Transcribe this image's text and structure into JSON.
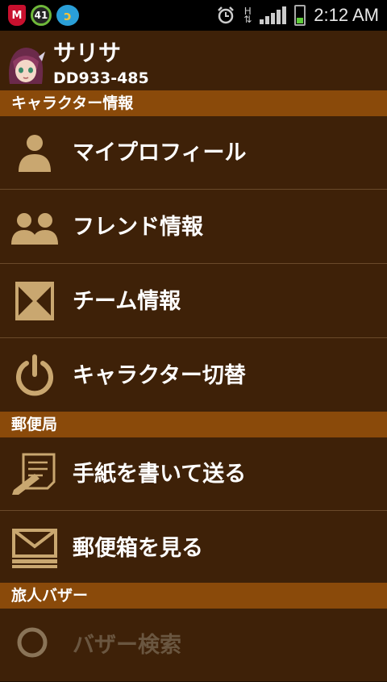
{
  "status_bar": {
    "notif_badge_count": "41",
    "network_type": "H",
    "time": "2:12 AM",
    "battery_level": 0.3
  },
  "profile": {
    "name": "サリサ",
    "id": "DD933-485"
  },
  "sections": [
    {
      "title": "キャラクター情報",
      "items": [
        {
          "label": "マイプロフィール",
          "icon": "person-icon"
        },
        {
          "label": "フレンド情報",
          "icon": "friends-icon"
        },
        {
          "label": "チーム情報",
          "icon": "hourglass-icon"
        },
        {
          "label": "キャラクター切替",
          "icon": "power-icon"
        }
      ]
    },
    {
      "title": "郵便局",
      "items": [
        {
          "label": "手紙を書いて送る",
          "icon": "write-letter-icon"
        },
        {
          "label": "郵便箱を見る",
          "icon": "mailbox-icon"
        }
      ]
    },
    {
      "title": "旅人バザー",
      "items": [
        {
          "label": "バザー検索",
          "icon": "search-icon"
        }
      ]
    }
  ],
  "colors": {
    "background": "#3e2108",
    "section_header": "#8a4a0a",
    "icon_tan": "#c9a770"
  }
}
